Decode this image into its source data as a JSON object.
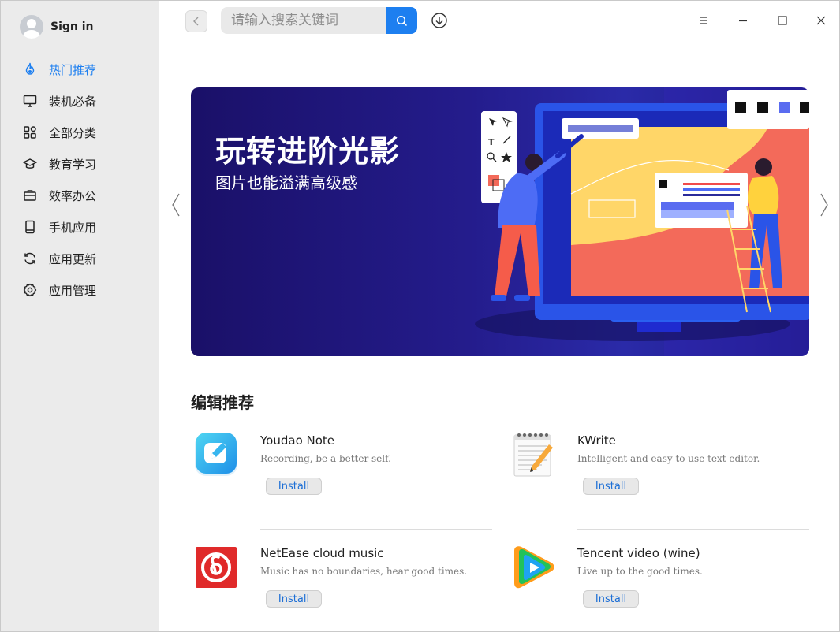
{
  "user": {
    "label": "Sign in"
  },
  "sidebar": {
    "items": [
      {
        "label": "热门推荐",
        "icon": "flame-icon",
        "active": true
      },
      {
        "label": "装机必备",
        "icon": "monitor-icon",
        "active": false
      },
      {
        "label": "全部分类",
        "icon": "grid-icon",
        "active": false
      },
      {
        "label": "教育学习",
        "icon": "graduation-cap-icon",
        "active": false
      },
      {
        "label": "效率办公",
        "icon": "briefcase-icon",
        "active": false
      },
      {
        "label": "手机应用",
        "icon": "phone-icon",
        "active": false
      },
      {
        "label": "应用更新",
        "icon": "refresh-icon",
        "active": false
      },
      {
        "label": "应用管理",
        "icon": "gear-icon",
        "active": false
      }
    ]
  },
  "search": {
    "placeholder": "请输入搜索关键词"
  },
  "banner": {
    "title": "玩转进阶光影",
    "subtitle": "图片也能溢满高级感"
  },
  "section": {
    "title": "编辑推荐"
  },
  "apps": [
    {
      "name": "Youdao Note",
      "desc": "Recording, be a better self.",
      "install": "Install",
      "icon": "youdao-note-icon"
    },
    {
      "name": "KWrite",
      "desc": "Intelligent and easy to use text editor.",
      "install": "Install",
      "icon": "kwrite-notepad-icon"
    },
    {
      "name": "NetEase cloud music",
      "desc": "Music has no boundaries, hear good times.",
      "install": "Install",
      "icon": "netease-music-icon"
    },
    {
      "name": "Tencent video (wine)",
      "desc": "Live up to the good times.",
      "install": "Install",
      "icon": "tencent-video-icon"
    }
  ],
  "colors": {
    "accent": "#1d7ff0",
    "sidebar_bg": "#ebebeb",
    "banner_bg": "#241c8c"
  }
}
